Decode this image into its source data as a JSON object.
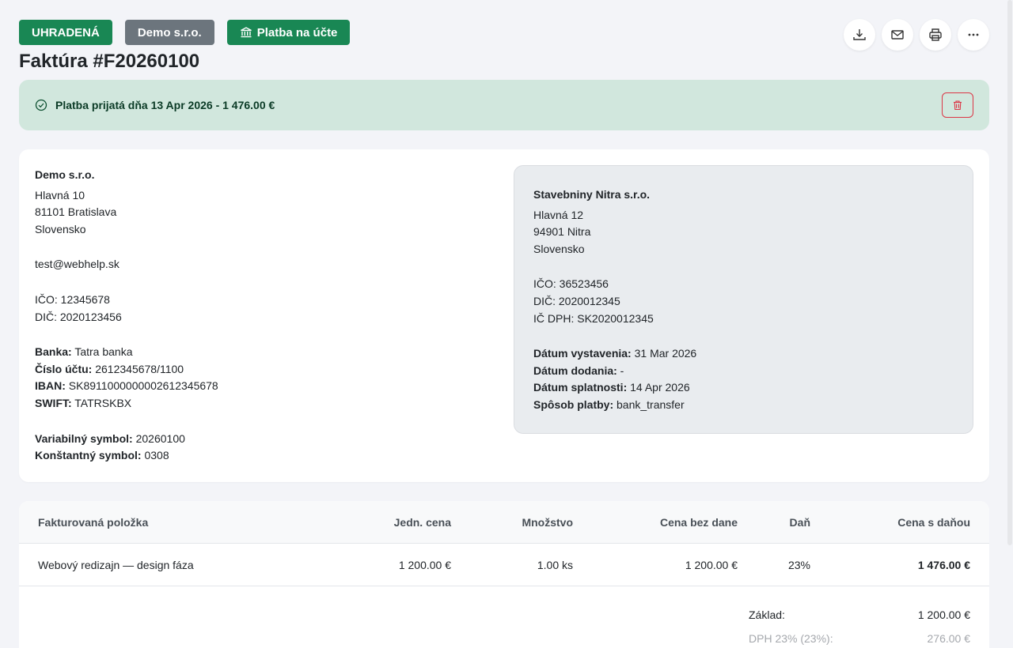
{
  "header": {
    "status_badge": "UHRADENÁ",
    "company_badge": "Demo s.r.o.",
    "payment_badge": "Platba na účte",
    "title": "Faktúra #F20260100"
  },
  "alert": {
    "text": "Platba prijatá dňa 13 Apr 2026 - 1 476.00 €"
  },
  "supplier": {
    "name": "Demo s.r.o.",
    "street": "Hlavná 10",
    "city": "81101 Bratislava",
    "country": "Slovensko",
    "email": "test@webhelp.sk",
    "ico": "IČO: 12345678",
    "dic": "DIČ: 2020123456",
    "bank_label": "Banka:",
    "bank": "Tatra banka",
    "account_label": "Číslo účtu:",
    "account": "2612345678/1100",
    "iban_label": "IBAN:",
    "iban": "SK8911000000002612345678",
    "swift_label": "SWIFT:",
    "swift": "TATRSKBX",
    "vs_label": "Variabilný symbol:",
    "vs": "20260100",
    "ks_label": "Konštantný symbol:",
    "ks": "0308"
  },
  "customer": {
    "name": "Stavebniny Nitra s.r.o.",
    "street": "Hlavná 12",
    "city": "94901 Nitra",
    "country": "Slovensko",
    "ico": "IČO: 36523456",
    "dic": "DIČ: 2020012345",
    "icdph": "IČ DPH: SK2020012345",
    "issue_label": "Dátum vystavenia:",
    "issue": "31 Mar 2026",
    "delivery_label": "Dátum dodania:",
    "delivery": "-",
    "due_label": "Dátum splatnosti:",
    "due": "14 Apr 2026",
    "method_label": "Spôsob platby:",
    "method": "bank_transfer"
  },
  "table": {
    "headers": [
      "Fakturovaná položka",
      "Jedn. cena",
      "Množstvo",
      "Cena bez dane",
      "Daň",
      "Cena s daňou"
    ],
    "rows": [
      [
        "Webový redizajn — design fáza",
        "1 200.00 €",
        "1.00 ks",
        "1 200.00 €",
        "23%",
        "1 476.00 €"
      ]
    ]
  },
  "summary": {
    "base_label": "Základ:",
    "base": "1 200.00 €",
    "vat_label": "DPH 23% (23%):",
    "vat": "276.00 €"
  }
}
